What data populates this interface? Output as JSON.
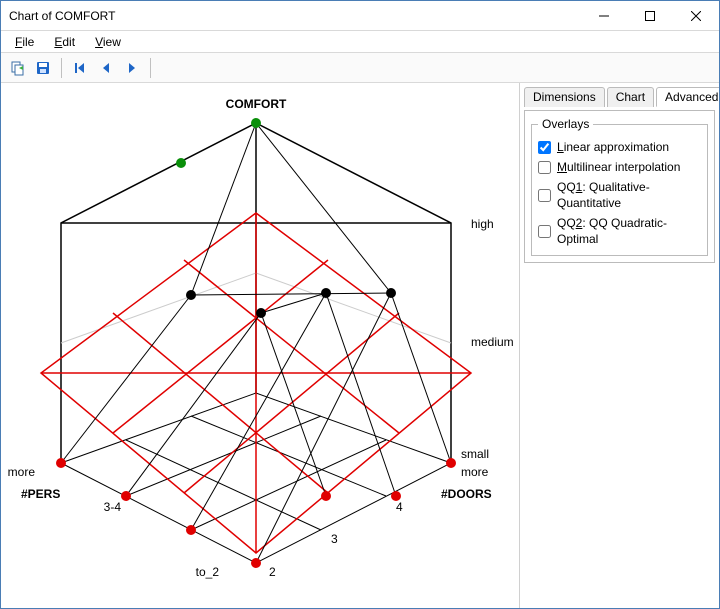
{
  "window": {
    "title": "Chart of COMFORT"
  },
  "menu": {
    "file": "File",
    "edit": "Edit",
    "view": "View"
  },
  "sidepanel": {
    "tabs": {
      "dimensions": "Dimensions",
      "chart": "Chart",
      "advanced": "Advanced"
    },
    "overlays_legend": "Overlays",
    "overlays": {
      "linear": {
        "label": "Linear approximation",
        "checked": true
      },
      "multilinear": {
        "label": "Multilinear interpolation",
        "checked": false
      },
      "qq1": {
        "label_prefix": "QQ",
        "label_u": "1",
        "label_rest": ": Qualitative-Quantitative",
        "checked": false
      },
      "qq2": {
        "label_prefix": "QQ",
        "label_u": "2",
        "label_rest": ": QQ Quadratic-Optimal",
        "checked": false
      }
    }
  },
  "chart_data": {
    "type": "3d-surface",
    "title": "COMFORT",
    "x_axis": {
      "label": "#DOORS",
      "ticks": [
        "2",
        "3",
        "4",
        "more"
      ]
    },
    "y_axis": {
      "label": "#PERS",
      "ticks": [
        "to_2",
        "3-4",
        "more"
      ]
    },
    "z_axis": {
      "label": "COMFORT",
      "ticks": [
        "small",
        "medium",
        "high"
      ]
    },
    "points": [
      {
        "doors": "2",
        "pers": "to_2",
        "comfort": "small"
      },
      {
        "doors": "3",
        "pers": "to_2",
        "comfort": "small"
      },
      {
        "doors": "4",
        "pers": "to_2",
        "comfort": "small"
      },
      {
        "doors": "more",
        "pers": "to_2",
        "comfort": "small"
      },
      {
        "doors": "2",
        "pers": "3-4",
        "comfort": "medium"
      },
      {
        "doors": "3",
        "pers": "3-4",
        "comfort": "medium"
      },
      {
        "doors": "4",
        "pers": "3-4",
        "comfort": "medium"
      },
      {
        "doors": "more",
        "pers": "3-4",
        "comfort": "medium"
      },
      {
        "doors": "2",
        "pers": "more",
        "comfort": "small"
      },
      {
        "doors": "more",
        "pers": "more",
        "comfort": "high"
      }
    ],
    "overlays": [
      "Linear approximation"
    ]
  }
}
